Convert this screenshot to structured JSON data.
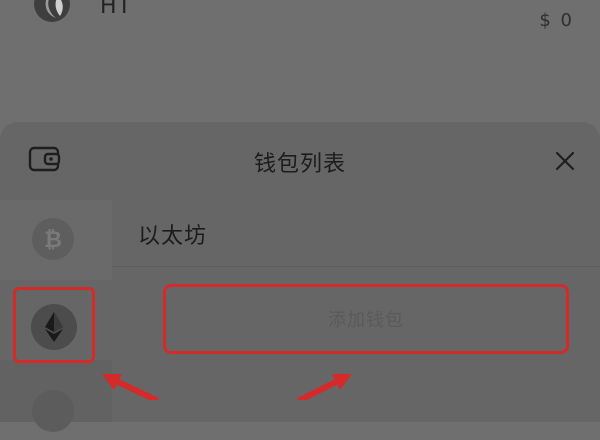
{
  "background_list": {
    "coin_name": "HT",
    "balance": "$ 0"
  },
  "sheet": {
    "title": "钱包列表",
    "icons": {
      "header_left": "wallet-icon",
      "close": "close-icon"
    },
    "chains": [
      {
        "icon": "bitcoin-icon",
        "selected": false
      },
      {
        "icon": "ethereum-icon",
        "selected": true
      },
      {
        "icon": "chain-icon",
        "selected": false
      }
    ],
    "selected_chain_name": "以太坊",
    "add_wallet_label": "添加钱包"
  },
  "colors": {
    "highlight": "#d42a2a",
    "sheet_bg": "#666666",
    "backdrop": "#6f6f6f"
  }
}
